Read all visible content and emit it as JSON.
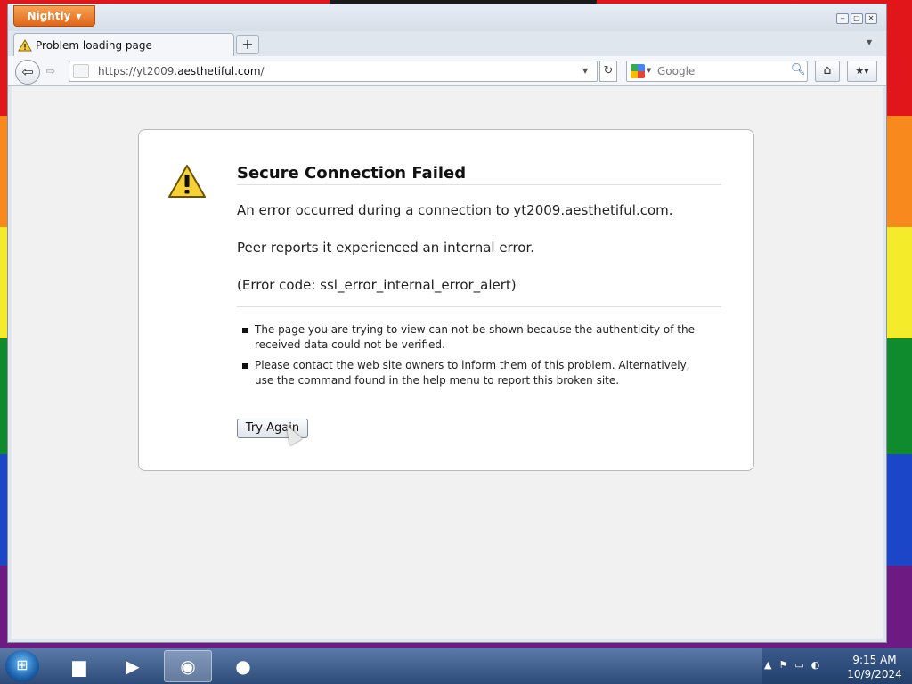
{
  "app": {
    "menu_button": "Nightly",
    "window_controls": [
      "minimize",
      "maximize",
      "close"
    ]
  },
  "tabs": [
    {
      "title": "Problem loading page",
      "icon": "warning-icon",
      "active": true
    }
  ],
  "toolbar": {
    "url_prefix": "https://yt2009.",
    "url_host": "aesthetiful.com",
    "url_suffix": "/",
    "search_engine": "Google",
    "search_placeholder": "Google"
  },
  "error": {
    "title": "Secure Connection Failed",
    "line1": "An error occurred during a connection to yt2009.aesthetiful.com.",
    "line2": "Peer reports it experienced an internal error.",
    "line3": "(Error code: ssl_error_internal_error_alert)",
    "bullets": [
      "The page you are trying to view can not be shown because the authenticity of the received data could not be verified.",
      "Please contact the web site owners to inform them of this problem. Alternatively, use the command found in the help menu to report this broken site."
    ],
    "button": "Try Again"
  },
  "taskbar": {
    "items": [
      "explorer-icon",
      "media-player-icon",
      "browser-globe-icon",
      "firefox-icon"
    ],
    "time": "9:15 AM",
    "date": "10/9/2024"
  }
}
